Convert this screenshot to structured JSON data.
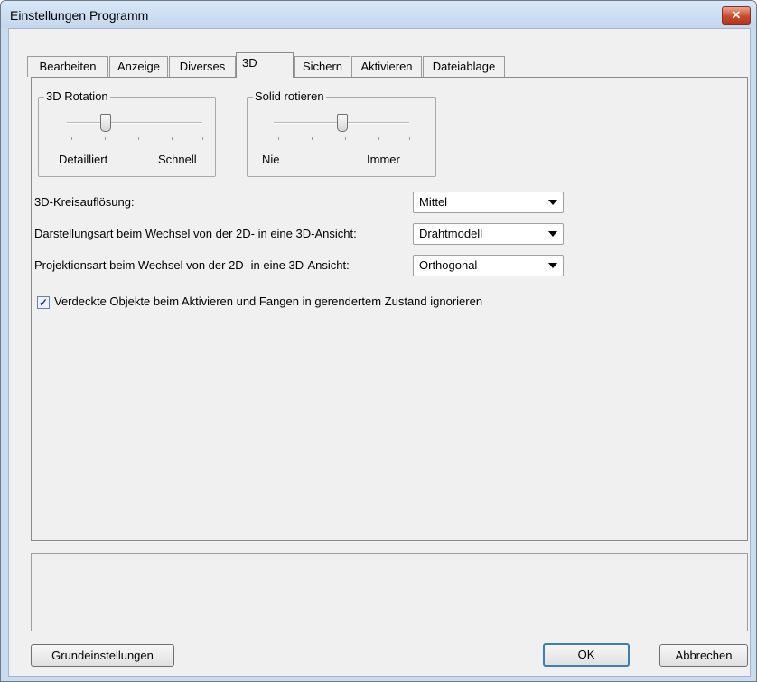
{
  "window": {
    "title": "Einstellungen Programm",
    "close_glyph": "✕"
  },
  "tabs": [
    {
      "label": "Bearbeiten"
    },
    {
      "label": "Anzeige"
    },
    {
      "label": "Diverses"
    },
    {
      "label": "3D",
      "active": true
    },
    {
      "label": "Sichern"
    },
    {
      "label": "Aktivieren"
    },
    {
      "label": "Dateiablage"
    }
  ],
  "rotation_group": {
    "title": "3D Rotation",
    "min_label": "Detailliert",
    "max_label": "Schnell",
    "ticks": 5,
    "position": 1
  },
  "solid_group": {
    "title": "Solid rotieren",
    "min_label": "Nie",
    "max_label": "Immer",
    "ticks": 5,
    "position": 2
  },
  "settings": [
    {
      "label": "3D-Kreisauflösung:",
      "value": "Mittel"
    },
    {
      "label": "Darstellungsart beim Wechsel von der 2D- in eine 3D-Ansicht:",
      "value": "Drahtmodell"
    },
    {
      "label": "Projektionsart beim Wechsel von der 2D- in eine 3D-Ansicht:",
      "value": "Orthogonal"
    }
  ],
  "ignore_hidden": {
    "checked": true,
    "check_glyph": "✓",
    "label": "Verdeckte Objekte beim Aktivieren und Fangen in gerendertem Zustand ignorieren"
  },
  "buttons": {
    "defaults": "Grundeinstellungen",
    "ok": "OK",
    "cancel": "Abbrechen"
  },
  "colors": {
    "default_button_border": "#3c7fb1",
    "close_button": "#c8492b"
  }
}
